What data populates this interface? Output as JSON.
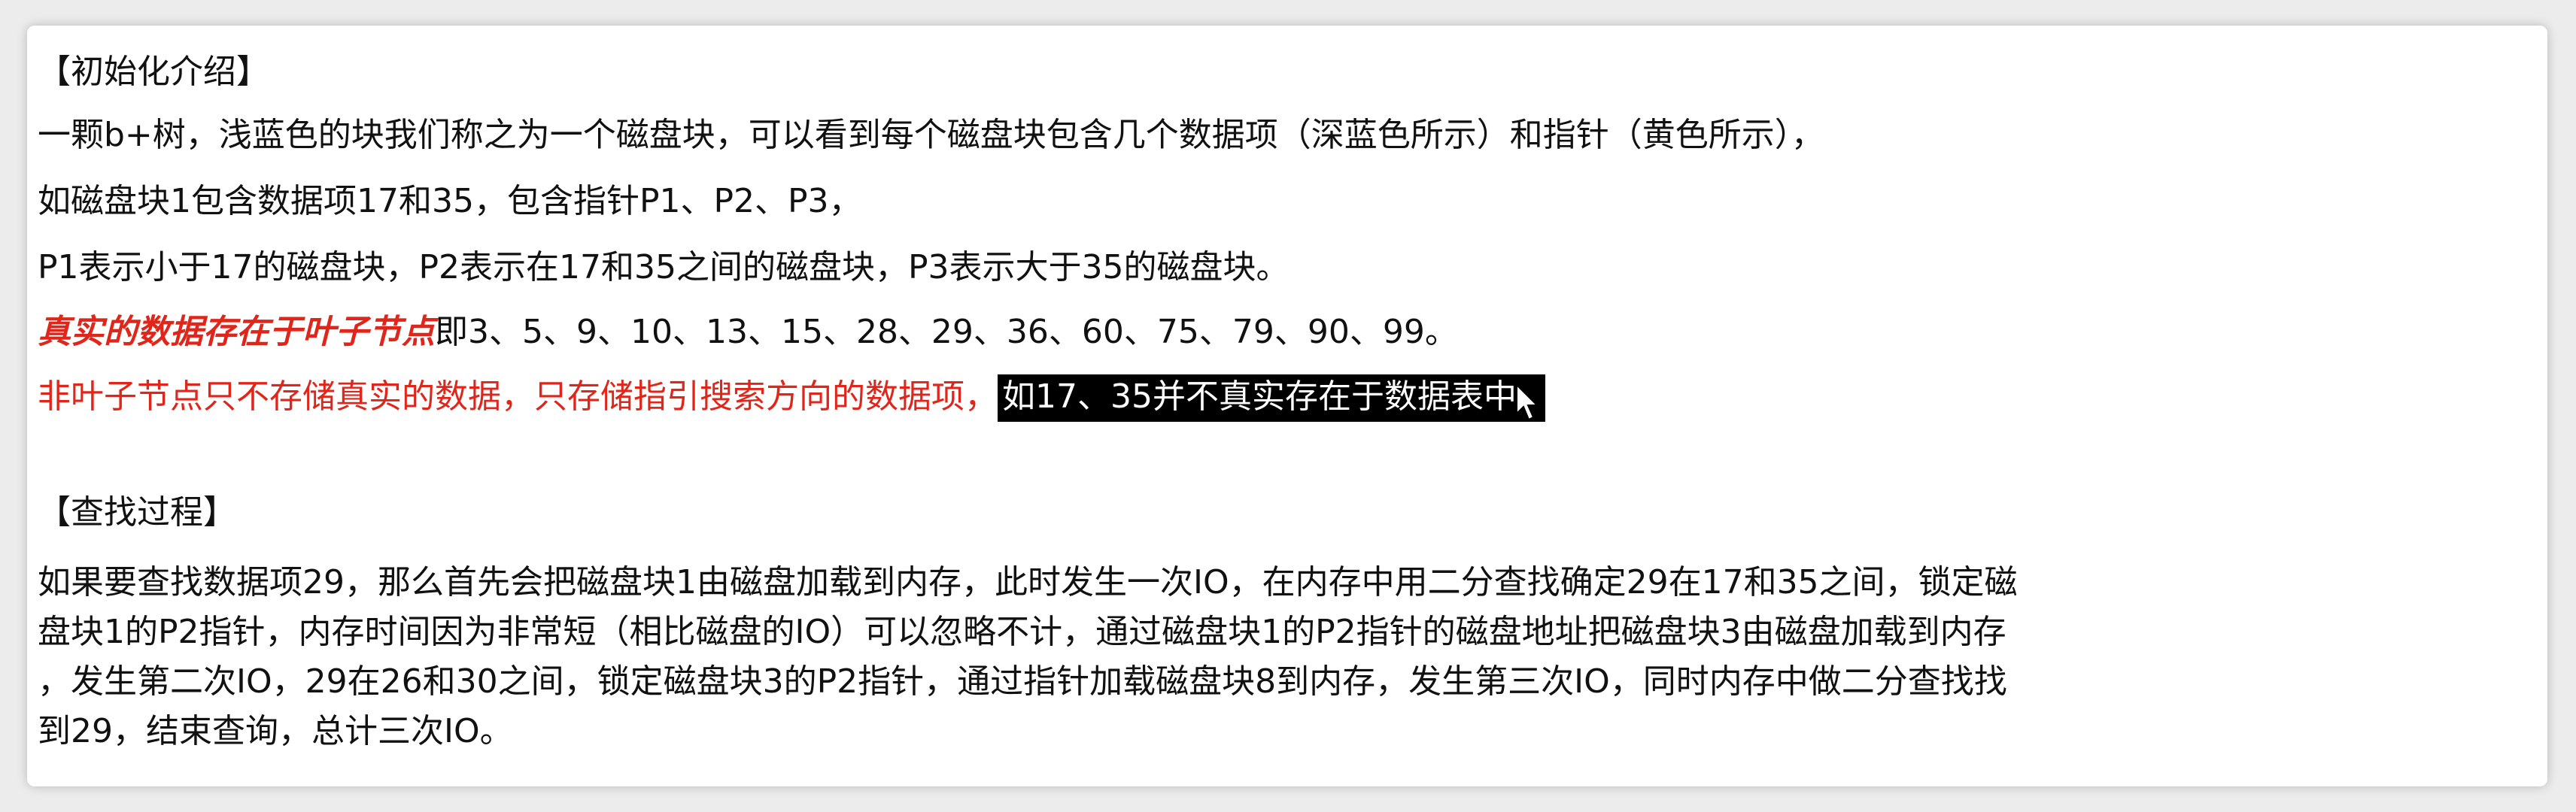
{
  "intro": {
    "heading": "【初始化介绍】",
    "l1": "一颗b+树，浅蓝色的块我们称之为一个磁盘块，可以看到每个磁盘块包含几个数据项（深蓝色所示）和指针（黄色所示），",
    "l2": "如磁盘块1包含数据项17和35，包含指针P1、P2、P3，",
    "l3": "P1表示小于17的磁盘块，P2表示在17和35之间的磁盘块，P3表示大于35的磁盘块。",
    "l4_emph": "真实的数据存在于叶子节点",
    "l4_rest": "即3、5、9、10、13、15、28、29、36、60、75、79、90、99。",
    "l5_red": "非叶子节点只不存储真实的数据，只存储指引搜索方向的数据项，",
    "l5_selected": "如17、35并不真实存在于数据表中"
  },
  "search": {
    "heading": "【查找过程】",
    "p1": "如果要查找数据项29，那么首先会把磁盘块1由磁盘加载到内存，此时发生一次IO，在内存中用二分查找确定29在17和35之间，锁定磁",
    "p2": "盘块1的P2指针，内存时间因为非常短（相比磁盘的IO）可以忽略不计，通过磁盘块1的P2指针的磁盘地址把磁盘块3由磁盘加载到内存",
    "p3": "，发生第二次IO，29在26和30之间，锁定磁盘块3的P2指针，通过指针加载磁盘块8到内存，发生第三次IO，同时内存中做二分查找找",
    "p4": "到29，结束查询，总计三次IO。"
  },
  "cursor_icon": "mouse-pointer-icon",
  "colors": {
    "red": "#e0261b",
    "selection_bg": "#000000",
    "selection_fg": "#ffffff"
  }
}
